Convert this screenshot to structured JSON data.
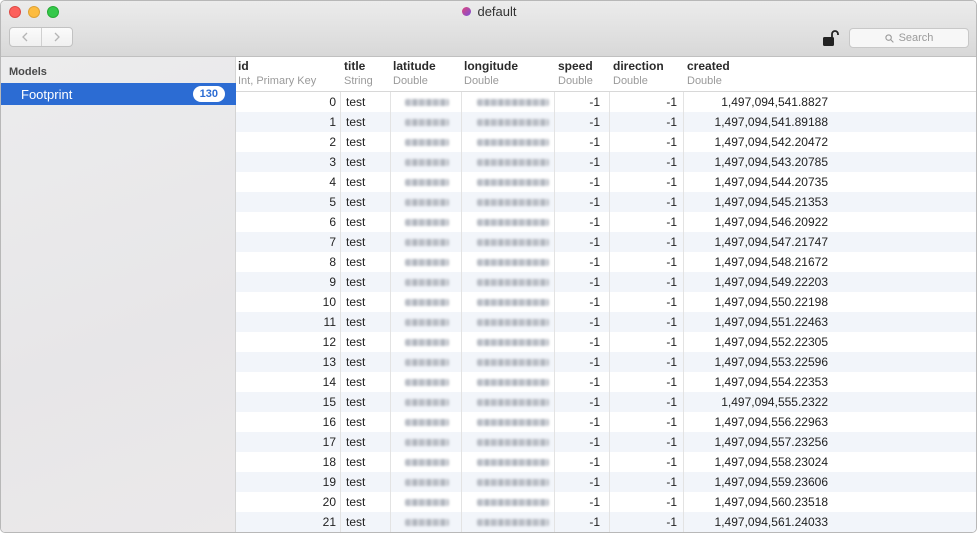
{
  "window": {
    "title": "default"
  },
  "toolbar": {
    "back_icon": "chevron-left-icon",
    "forward_icon": "chevron-right-icon",
    "lock_icon": "unlocked-padlock-icon",
    "search_placeholder": "Search"
  },
  "sidebar": {
    "section_label": "Models",
    "items": [
      {
        "label": "Footprint",
        "count": "130",
        "selected": true
      }
    ]
  },
  "table": {
    "columns": [
      {
        "name": "id",
        "type": "Int, Primary Key"
      },
      {
        "name": "title",
        "type": "String"
      },
      {
        "name": "latitude",
        "type": "Double"
      },
      {
        "name": "longitude",
        "type": "Double"
      },
      {
        "name": "speed",
        "type": "Double"
      },
      {
        "name": "direction",
        "type": "Double"
      },
      {
        "name": "created",
        "type": "Double"
      }
    ],
    "rows": [
      {
        "id": "0",
        "title": "test",
        "speed": "-1",
        "direction": "-1",
        "created": "1,497,094,541.8827"
      },
      {
        "id": "1",
        "title": "test",
        "speed": "-1",
        "direction": "-1",
        "created": "1,497,094,541.89188"
      },
      {
        "id": "2",
        "title": "test",
        "speed": "-1",
        "direction": "-1",
        "created": "1,497,094,542.20472"
      },
      {
        "id": "3",
        "title": "test",
        "speed": "-1",
        "direction": "-1",
        "created": "1,497,094,543.20785"
      },
      {
        "id": "4",
        "title": "test",
        "speed": "-1",
        "direction": "-1",
        "created": "1,497,094,544.20735"
      },
      {
        "id": "5",
        "title": "test",
        "speed": "-1",
        "direction": "-1",
        "created": "1,497,094,545.21353"
      },
      {
        "id": "6",
        "title": "test",
        "speed": "-1",
        "direction": "-1",
        "created": "1,497,094,546.20922"
      },
      {
        "id": "7",
        "title": "test",
        "speed": "-1",
        "direction": "-1",
        "created": "1,497,094,547.21747"
      },
      {
        "id": "8",
        "title": "test",
        "speed": "-1",
        "direction": "-1",
        "created": "1,497,094,548.21672"
      },
      {
        "id": "9",
        "title": "test",
        "speed": "-1",
        "direction": "-1",
        "created": "1,497,094,549.22203"
      },
      {
        "id": "10",
        "title": "test",
        "speed": "-1",
        "direction": "-1",
        "created": "1,497,094,550.22198"
      },
      {
        "id": "11",
        "title": "test",
        "speed": "-1",
        "direction": "-1",
        "created": "1,497,094,551.22463"
      },
      {
        "id": "12",
        "title": "test",
        "speed": "-1",
        "direction": "-1",
        "created": "1,497,094,552.22305"
      },
      {
        "id": "13",
        "title": "test",
        "speed": "-1",
        "direction": "-1",
        "created": "1,497,094,553.22596"
      },
      {
        "id": "14",
        "title": "test",
        "speed": "-1",
        "direction": "-1",
        "created": "1,497,094,554.22353"
      },
      {
        "id": "15",
        "title": "test",
        "speed": "-1",
        "direction": "-1",
        "created": "1,497,094,555.2322"
      },
      {
        "id": "16",
        "title": "test",
        "speed": "-1",
        "direction": "-1",
        "created": "1,497,094,556.22963"
      },
      {
        "id": "17",
        "title": "test",
        "speed": "-1",
        "direction": "-1",
        "created": "1,497,094,557.23256"
      },
      {
        "id": "18",
        "title": "test",
        "speed": "-1",
        "direction": "-1",
        "created": "1,497,094,558.23024"
      },
      {
        "id": "19",
        "title": "test",
        "speed": "-1",
        "direction": "-1",
        "created": "1,497,094,559.23606"
      },
      {
        "id": "20",
        "title": "test",
        "speed": "-1",
        "direction": "-1",
        "created": "1,497,094,560.23518"
      },
      {
        "id": "21",
        "title": "test",
        "speed": "-1",
        "direction": "-1",
        "created": "1,497,094,561.24033"
      }
    ]
  }
}
